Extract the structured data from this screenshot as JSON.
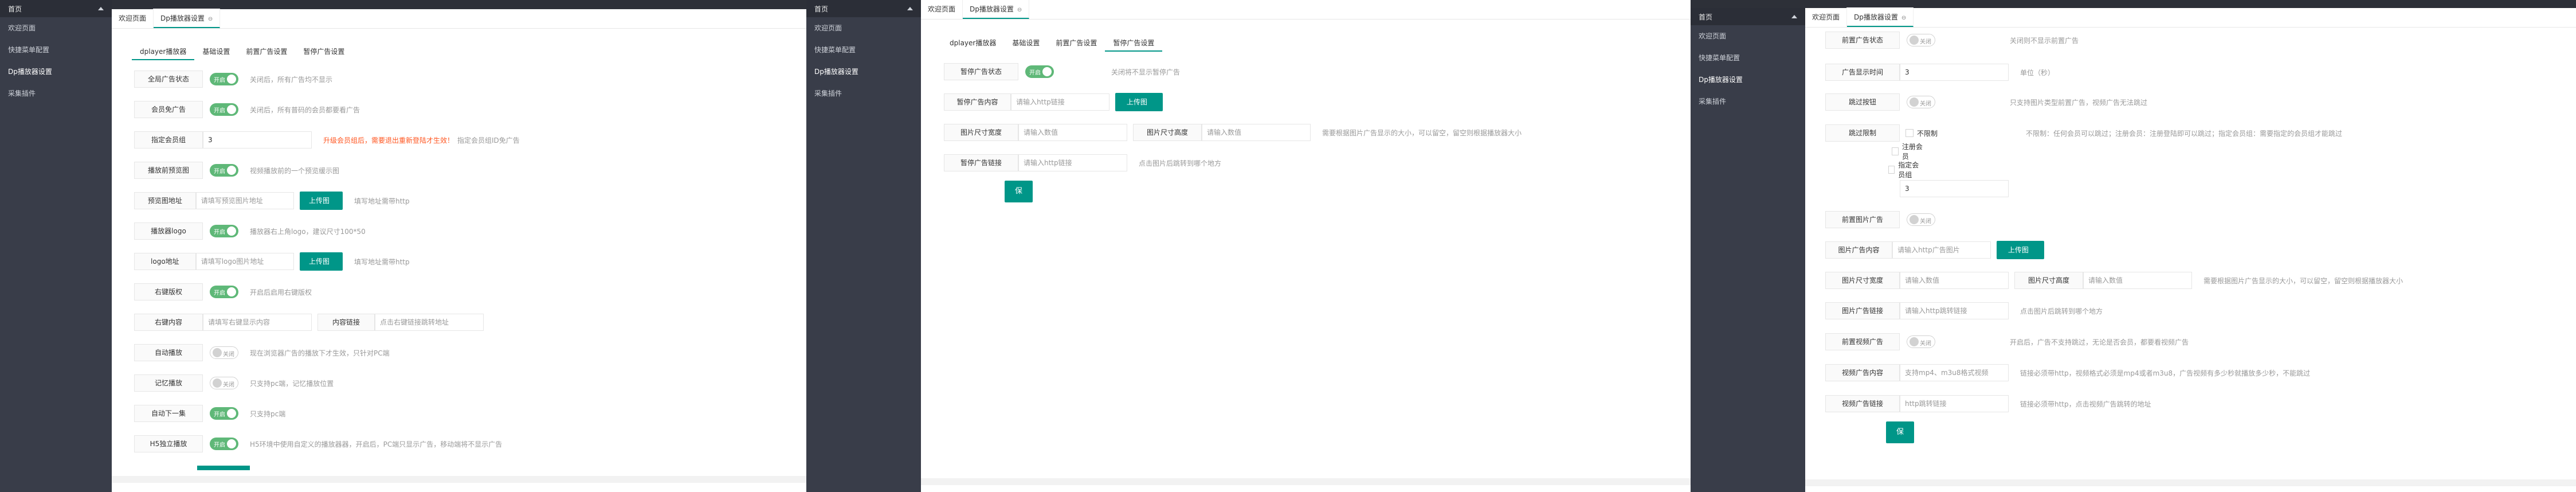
{
  "sidebar": {
    "home": "首页",
    "items": [
      "欢迎页面",
      "快捷菜单配置",
      "Dp播放器设置",
      "采集插件"
    ]
  },
  "tabs": {
    "welcome": "欢迎页面",
    "player": "Dp播放器设置",
    "close": "⊖"
  },
  "subtabs": [
    "dplayer播放器",
    "基础设置",
    "前置广告设置",
    "暂停广告设置"
  ],
  "switch_on": "开启",
  "switch_off": "关闭",
  "upload": "上传图片",
  "save": "保存配置",
  "pane1": {
    "rows": [
      {
        "label": "全局广告状态",
        "hint": "关闭后，所有广告均不显示"
      },
      {
        "label": "会员免广告",
        "hint": "关闭后，所有普码的会员都要看广告"
      },
      {
        "label": "指定会员组",
        "value": "3",
        "hint_red": "升级会员组后，需要退出重新登陆才生效！",
        "hint": "指定会员组ID免广告"
      },
      {
        "label": "播放前预览图",
        "hint": "视频播放前的一个预览缓示图"
      },
      {
        "label": "预览图地址",
        "placeholder": "请填写预览图片地址",
        "hint": "填写地址需带http"
      },
      {
        "label": "播放器logo",
        "hint": "播放器右上角logo，建议尺寸100*50"
      },
      {
        "label": "logo地址",
        "placeholder": "请填写logo图片地址",
        "hint": "填写地址需带http"
      },
      {
        "label": "右键版权",
        "hint": "开启后启用右键版权"
      },
      {
        "label": "右键内容",
        "placeholder": "请填写右键显示内容",
        "label2": "内容链接",
        "placeholder2": "点击右键链接跳转地址"
      },
      {
        "label": "自动播放",
        "hint": "现在浏览器广告的播放下才生效，只针对PC端"
      },
      {
        "label": "记忆播放",
        "hint": "只支持pc端，记忆播放位置"
      },
      {
        "label": "自动下一集",
        "hint": "只支持pc端"
      },
      {
        "label": "H5独立播放",
        "hint": "H5环境中使用自定义的播放器器，开启后，PC端只显示广告，移动端将不显示广告"
      }
    ]
  },
  "pane2": {
    "rows": [
      {
        "label": "暂停广告状态",
        "hint": "关闭将不显示暂停广告"
      },
      {
        "label": "暂停广告内容",
        "placeholder": "请输入http链接"
      },
      {
        "label": "图片尺寸宽度",
        "placeholder": "请输入数值",
        "label2": "图片尺寸高度",
        "placeholder2": "请输入数值",
        "hint": "需要根据图片广告显示的大小，可以留空，留空则根据播放器大小"
      },
      {
        "label": "暂停广告链接",
        "placeholder": "请输入http链接",
        "hint": "点击图片后跳转到哪个地方"
      }
    ]
  },
  "pane3": {
    "rows": [
      {
        "label": "前置广告状态",
        "hint": "关闭则不显示前置广告"
      },
      {
        "label": "广告显示时间",
        "value": "3",
        "hint": "单位（秒）"
      },
      {
        "label": "跳过按钮",
        "hint": "只支持图片类型前置广告，视频广告无法跳过"
      },
      {
        "label": "跳过限制",
        "hint": "不限制：任何会员可以跳过；注册会员：注册登陆即可以跳过；指定会员组：需要指定的会员组才能跳过",
        "options": [
          "不限制",
          "注册会员",
          "指定会员组"
        ],
        "group_value": "3"
      },
      {
        "label": "前置图片广告"
      },
      {
        "label": "图片广告内容",
        "placeholder": "请输入http广告图片"
      },
      {
        "label": "图片尺寸宽度",
        "placeholder": "请输入数值",
        "label2": "图片尺寸高度",
        "placeholder2": "请输入数值",
        "hint": "需要根据图片广告显示的大小，可以留空，留空则根据播放器大小"
      },
      {
        "label": "图片广告链接",
        "placeholder": "请输入http跳转链接",
        "hint": "点击图片后跳转到哪个地方"
      },
      {
        "label": "前置视频广告",
        "hint": "开启后，广告不支持跳过，无论是否会员，都要看视频广告"
      },
      {
        "label": "视频广告内容",
        "placeholder": "支持mp4、m3u8格式视频",
        "hint": "链接必须带http，视频格式必须是mp4或者m3u8，广告视频有多少秒就播放多少秒，不能跳过"
      },
      {
        "label": "视频广告链接",
        "placeholder": "http跳转链接",
        "hint": "链接必须带http，点击视频广告跳转的地址"
      }
    ]
  }
}
